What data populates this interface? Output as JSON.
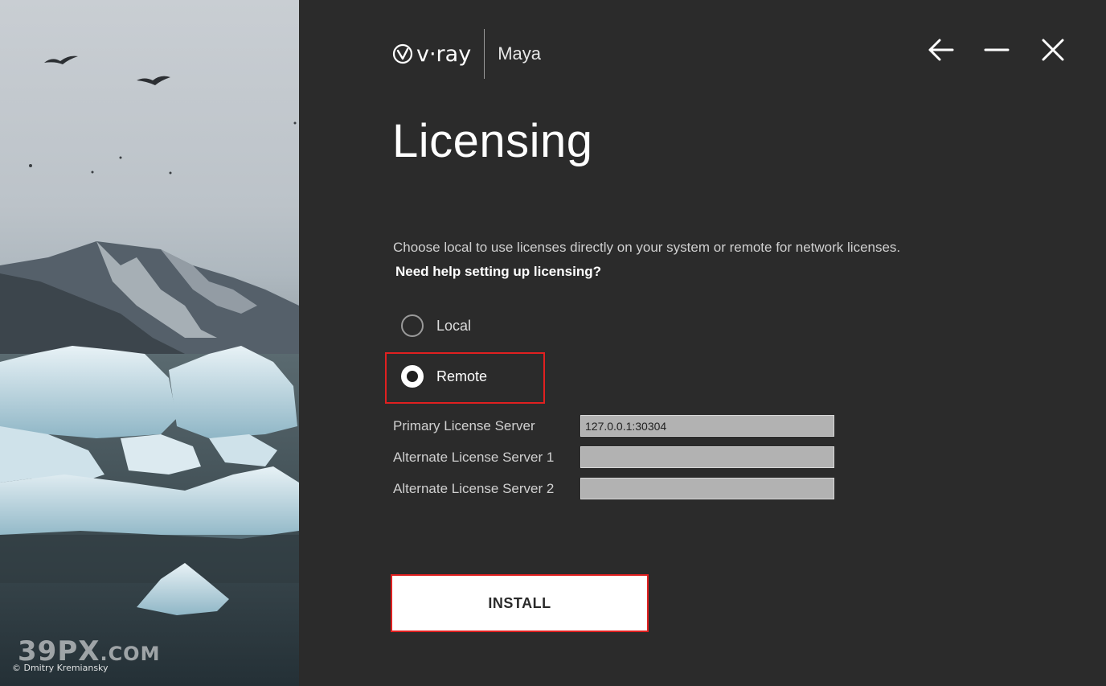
{
  "photo": {
    "watermark_main": "39PX",
    "watermark_suffix": ".COM",
    "credit": "© Dmitry Kremiansky"
  },
  "header": {
    "logo_text": "v·ray",
    "product": "Maya",
    "logo_icon": "vray-logo-icon"
  },
  "window_controls": {
    "back_icon": "arrow-left-icon",
    "minimize_icon": "minimize-icon",
    "close_icon": "close-icon"
  },
  "page": {
    "title": "Licensing",
    "description": "Choose local to use licenses directly on your system or remote for network licenses.",
    "help_link": "Need help setting up licensing?"
  },
  "license_type": {
    "options": [
      {
        "label": "Local",
        "checked": false
      },
      {
        "label": "Remote",
        "checked": true
      }
    ]
  },
  "servers": {
    "primary_label": "Primary License Server",
    "primary_value": "127.0.0.1:30304",
    "alt1_label": "Alternate License Server 1",
    "alt1_value": "",
    "alt2_label": "Alternate License Server 2",
    "alt2_value": ""
  },
  "actions": {
    "install_label": "INSTALL"
  },
  "colors": {
    "background": "#2b2b2b",
    "highlight": "#e02020",
    "input_bg": "#b2b2b2"
  }
}
